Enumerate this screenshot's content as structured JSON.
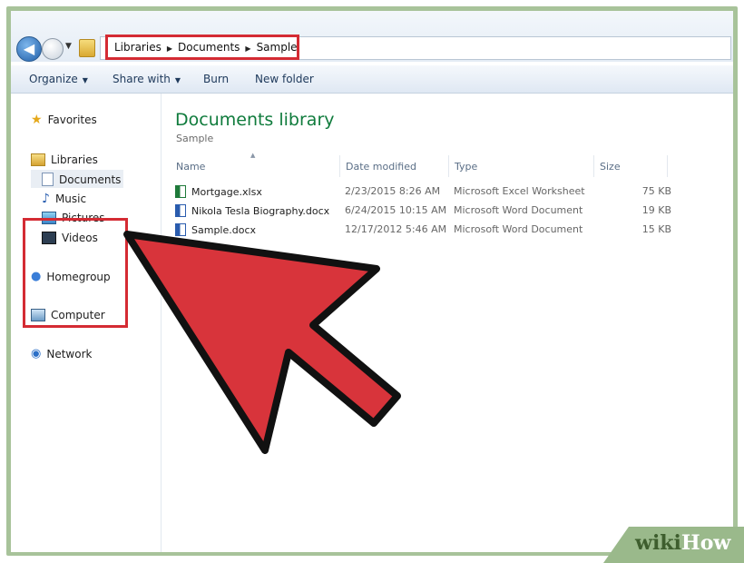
{
  "breadcrumb": [
    "Libraries",
    "Documents",
    "Sample"
  ],
  "toolbar": {
    "organize": "Organize",
    "share_with": "Share with",
    "burn": "Burn",
    "new_folder": "New folder"
  },
  "sidebar": {
    "favorites": "Favorites",
    "libraries": "Libraries",
    "library_items": [
      "Documents",
      "Music",
      "Pictures",
      "Videos"
    ],
    "homegroup": "Homegroup",
    "computer": "Computer",
    "network": "Network"
  },
  "library": {
    "title": "Documents library",
    "subtitle": "Sample"
  },
  "columns": {
    "name": "Name",
    "date": "Date modified",
    "type": "Type",
    "size": "Size"
  },
  "files": [
    {
      "name": "Mortgage.xlsx",
      "date": "2/23/2015 8:26 AM",
      "type": "Microsoft Excel Worksheet",
      "size": "75 KB",
      "icon": "excel-file-icon"
    },
    {
      "name": "Nikola Tesla Biography.docx",
      "date": "6/24/2015 10:15 AM",
      "type": "Microsoft Word Document",
      "size": "19 KB",
      "icon": "word-file-icon"
    },
    {
      "name": "Sample.docx",
      "date": "12/17/2012 5:46 AM",
      "type": "Microsoft Word Document",
      "size": "15 KB",
      "icon": "word-file-icon"
    }
  ],
  "watermark": {
    "wiki": "wiki",
    "how": "How"
  },
  "colors": {
    "highlight": "#d42b33",
    "arrow_fill": "#d8343b",
    "library_title": "#0f7b3c",
    "frame": "#a8c39a"
  }
}
